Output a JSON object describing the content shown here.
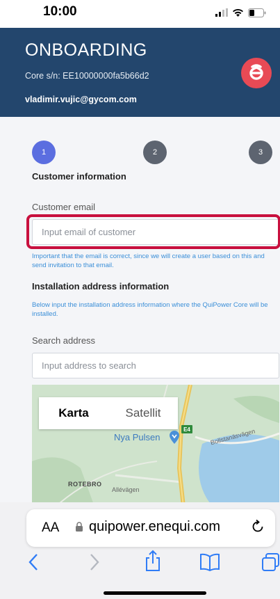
{
  "status_bar": {
    "time": "10:00"
  },
  "header": {
    "title": "ONBOARDING",
    "serial": "Core s/n: EE10000000fa5b66d2",
    "email": "vladimir.vujic@gycom.com"
  },
  "steps": [
    "1",
    "2",
    "3"
  ],
  "customer_section": {
    "title": "Customer information",
    "email_label": "Customer email",
    "email_placeholder": "Input email of customer",
    "email_help": "Important that the email is correct, since we will create a user based on this and send invitation to that email."
  },
  "address_section": {
    "title": "Installation address information",
    "help": "Below input the installation address information where the QuiPower Core will be installed.",
    "search_label": "Search address",
    "search_placeholder": "Input address to search"
  },
  "map": {
    "tabs": [
      "Karta",
      "Satellit"
    ],
    "poi": "Nya Pulsen",
    "route_sign": "E4",
    "road_label_1": "Bollstanäsvägen",
    "road_label_2": "Allévägen",
    "place": "ROTEBRO"
  },
  "browser": {
    "text_size_label": "AA",
    "url": "quipower.enequi.com"
  },
  "colors": {
    "header_bg": "#23466d",
    "accent": "#e84a55",
    "step_active": "#5b6ee0",
    "help_text": "#3b8fd8",
    "highlight": "#c8103e"
  }
}
